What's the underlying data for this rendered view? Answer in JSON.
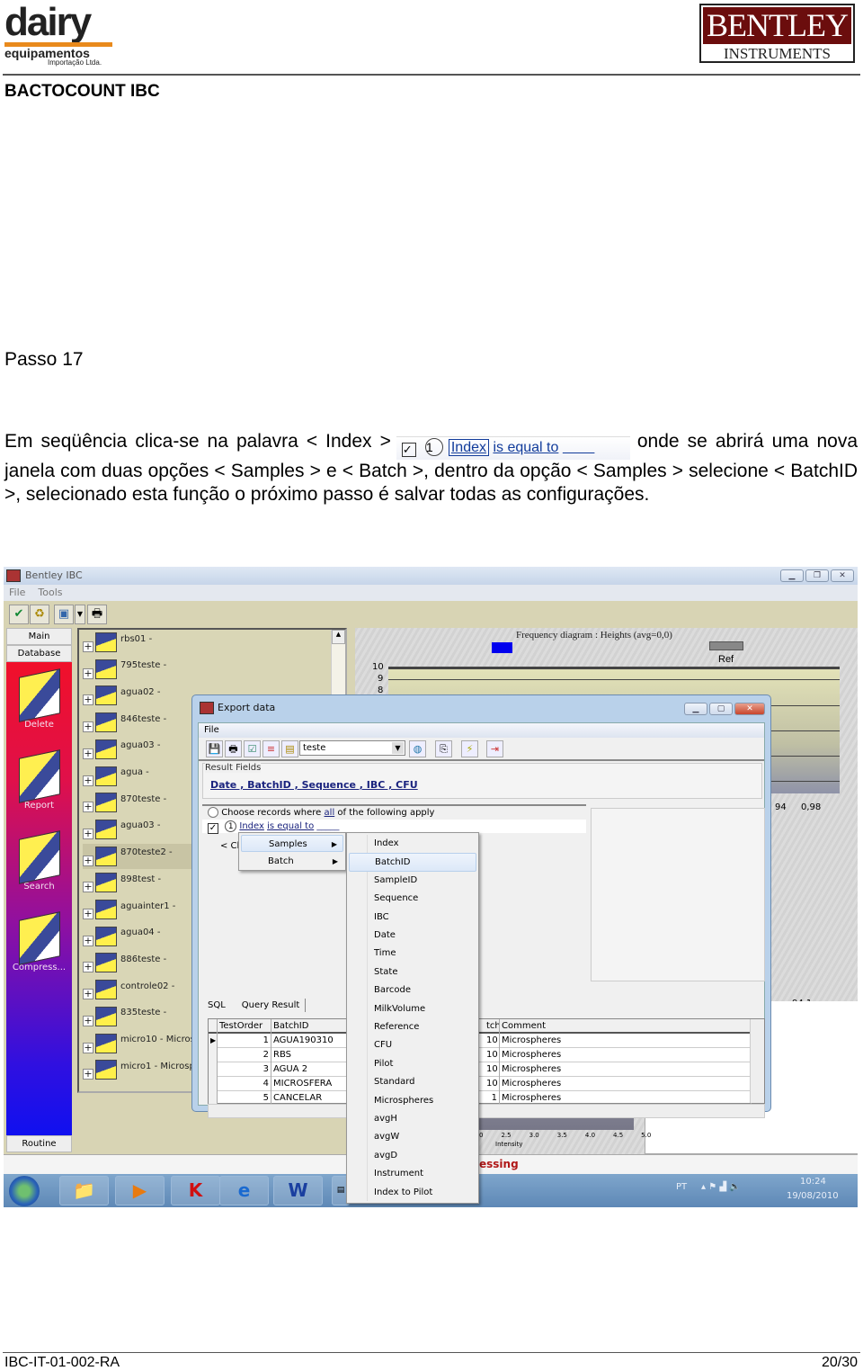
{
  "header": {
    "logo_left": {
      "word": "dairy",
      "sub": "equipamentos",
      "sub2": "Importação Ltda."
    },
    "logo_right": {
      "top": "BENTLEY",
      "bottom": "INSTRUMENTS"
    },
    "title": "BACTOCOUNT IBC",
    "brand_color": "#6b0d0d",
    "accent_color": "#e98a1c"
  },
  "step": "Passo 17",
  "paragraph": {
    "before": "Em seqüência clica-se na palavra < Index >",
    "inline": {
      "circle": "1",
      "index": "Index",
      "rest": "is equal to"
    },
    "after": "onde se abrirá uma nova janela com duas opções < Samples > e < Batch >, dentro da opção < Samples > selecione < BatchID >, selecionado esta função o próximo passo é salvar todas as configurações."
  },
  "app": {
    "title": "Bentley IBC",
    "menu": [
      "File",
      "Tools"
    ],
    "left_tabs": {
      "main": "Main",
      "database": "Database",
      "routine": "Routine"
    },
    "left_buttons": [
      "Delete",
      "Report",
      "Search",
      "Compress..."
    ],
    "tree": [
      "rbs01  -",
      "795teste  -",
      "agua02  -",
      "846teste  -",
      "agua03  -",
      "agua  -",
      "870teste  -",
      "agua03  -",
      "870teste2  -",
      "898test  -",
      "aguainter1  -",
      "agua04  -",
      "886teste  -",
      "controle02  -",
      "835teste  -",
      "micro10  -  Micros",
      "micro1  -  Microsp"
    ],
    "tree_selected": 8,
    "chart": {
      "title": "Frequency diagram : Heights (avg=0,0)",
      "legend_ref": "Ref",
      "legend_colors": {
        "series": "#0000ee",
        "ref": "#888888"
      },
      "y_ticks": [
        "10",
        "9",
        "8"
      ],
      "x_ticks": [
        "94",
        "0,98"
      ],
      "lower_tick": "94,1",
      "lower_x_ticks": [
        "0",
        "2.5",
        "3.0",
        "3.5",
        "4.0",
        "4.5",
        "5.0"
      ],
      "lower_xlabel": "Intensity"
    },
    "status_text": "essing",
    "taskbar": {
      "lang": "PT",
      "time": "10:24",
      "date": "19/08/2010"
    }
  },
  "dialog": {
    "title": "Export data",
    "menu": "File",
    "combo": "teste",
    "result_fields_label": "Result Fields",
    "result_fields": "Date , BatchID , Sequence , IBC , CFU",
    "choose": {
      "pre": "Choose records where",
      "all": "all",
      "post": "of the following apply"
    },
    "condition": {
      "num": "1",
      "field": "Index",
      "op": "is equal to",
      "value": "_____"
    },
    "click_hint": "< Cli",
    "tabs": [
      "SQL",
      "Query Result"
    ],
    "grid": {
      "headers": [
        "TestOrder",
        "BatchID",
        "tch",
        "Comment"
      ],
      "rows": [
        [
          "1",
          "AGUA190310",
          "10",
          "Microspheres"
        ],
        [
          "2",
          "RBS",
          "10",
          "Microspheres"
        ],
        [
          "3",
          "AGUA 2",
          "10",
          "Microspheres"
        ],
        [
          "4",
          "MICROSFERA",
          "10",
          "Microspheres"
        ],
        [
          "5",
          "CANCELAR",
          "1",
          "Microspheres"
        ]
      ]
    }
  },
  "context_menu": {
    "items": [
      "Samples",
      "Batch"
    ],
    "hot": 0
  },
  "submenu": {
    "items": [
      "Index",
      "BatchID",
      "SampleID",
      "Sequence",
      "IBC",
      "Date",
      "Time",
      "State",
      "Barcode",
      "MilkVolume",
      "Reference",
      "CFU",
      "Pilot",
      "Standard",
      "Microspheres",
      "avgH",
      "avgW",
      "avgD",
      "Instrument",
      "Index to Pilot"
    ],
    "hot": 1
  },
  "footer": {
    "code": "IBC-IT-01-002-RA",
    "page": "20/30"
  }
}
